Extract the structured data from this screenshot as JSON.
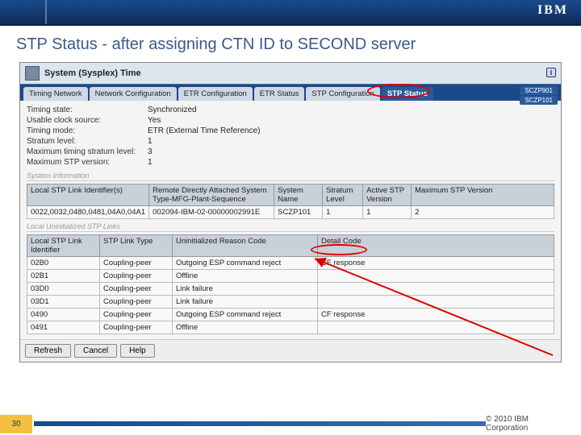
{
  "brand": "IBM",
  "slide_title": "STP Status - after assigning CTN ID to SECOND server",
  "panel_title": "System (Sysplex) Time",
  "tabs": [
    {
      "label": "Timing Network"
    },
    {
      "label": "Network Configuration"
    },
    {
      "label": "ETR Configuration"
    },
    {
      "label": "ETR Status"
    },
    {
      "label": "STP Configuration"
    },
    {
      "label": "STP Status"
    }
  ],
  "side_labels": [
    "SCZP901",
    "SCZP101"
  ],
  "status": {
    "rows": [
      {
        "label": "Timing state:",
        "value": "Synchronized"
      },
      {
        "label": "Usable clock source:",
        "value": "Yes"
      },
      {
        "label": "Timing mode:",
        "value": "ETR (External Time Reference)"
      },
      {
        "label": "Stratum level:",
        "value": "1"
      },
      {
        "label": "Maximum timing stratum level:",
        "value": "3"
      },
      {
        "label": "Maximum STP version:",
        "value": "1"
      }
    ]
  },
  "section_sysinfo": "System Information",
  "sysinfo_headers": [
    "Local STP Link Identifier(s)",
    "Remote Directly Attached System Type-MFG-Plant-Sequence",
    "System Name",
    "Stratum Level",
    "Active STP Version",
    "Maximum STP Version"
  ],
  "sysinfo_row": {
    "local": "0022,0032,0480,0481,04A0,04A1",
    "remote": "002094-IBM-02-00000002991E",
    "name": "SCZP101",
    "stratum": "1",
    "active": "1",
    "max": "2"
  },
  "section_uninit": "Local Uninitialized STP Links",
  "uninit_headers": [
    "Local STP Link Identifier",
    "STP Link Type",
    "Uninitialized Reason Code",
    "Detail Code"
  ],
  "uninit_rows": [
    {
      "id": "02B0",
      "type": "Coupling-peer",
      "reason": "Outgoing ESP command reject",
      "detail": "CF response"
    },
    {
      "id": "02B1",
      "type": "Coupling-peer",
      "reason": "Offline",
      "detail": ""
    },
    {
      "id": "03D0",
      "type": "Coupling-peer",
      "reason": "Link failure",
      "detail": ""
    },
    {
      "id": "03D1",
      "type": "Coupling-peer",
      "reason": "Link failure",
      "detail": ""
    },
    {
      "id": "0490",
      "type": "Coupling-peer",
      "reason": "Outgoing ESP command reject",
      "detail": "CF response"
    },
    {
      "id": "0491",
      "type": "Coupling-peer",
      "reason": "Offline",
      "detail": ""
    }
  ],
  "buttons": {
    "refresh": "Refresh",
    "cancel": "Cancel",
    "help": "Help"
  },
  "footer": {
    "page": "30",
    "copyright": "© 2010 IBM Corporation"
  }
}
